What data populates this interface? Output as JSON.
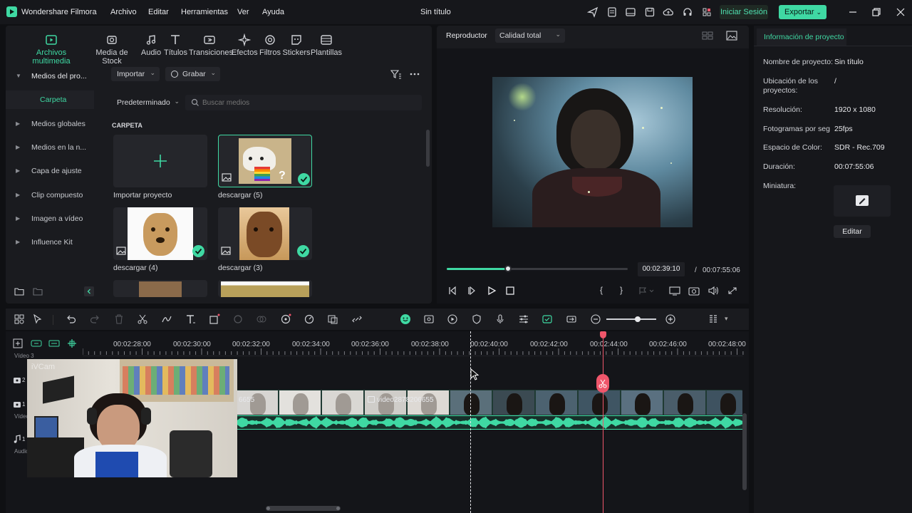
{
  "app": {
    "name": "Wondershare Filmora",
    "document_title": "Sin título",
    "menu": [
      "Archivo",
      "Editar",
      "Herramientas",
      "Ver",
      "Ayuda"
    ],
    "login_label": "Iniciar Sesión",
    "export_label": "Exportar"
  },
  "media": {
    "categories": [
      "Archivos multimedia",
      "Media de Stock",
      "Audio",
      "Títulos",
      "Transiciones",
      "Efectos",
      "Filtros",
      "Stickers",
      "Plantillas"
    ],
    "side_nav": {
      "header": "Medios del pro...",
      "items": [
        "Carpeta",
        "Medios globales",
        "Medios en la n...",
        "Capa de ajuste",
        "Clip compuesto",
        "Imagen a vídeo",
        "Influence Kit"
      ]
    },
    "import_label": "Importar",
    "record_label": "Grabar",
    "sort_label": "Predeterminado",
    "search_placeholder": "Buscar medios",
    "folder_heading": "CARPETA",
    "import_project_label": "Importar proyecto",
    "items": [
      "descargar (5)",
      "descargar (4)",
      "descargar (3)"
    ]
  },
  "player": {
    "label": "Reproductor",
    "quality": "Calidad total",
    "current_time": "00:02:39:10",
    "separator": "/",
    "total_time": "00:07:55:06",
    "progress": 0.34
  },
  "project_info": {
    "tab_label": "Información de proyecto",
    "fields": [
      {
        "label": "Nombre de proyecto:",
        "value": "Sin título"
      },
      {
        "label": "Ubicación de los proyectos:",
        "value": "/"
      },
      {
        "label": "Resolución:",
        "value": "1920 x 1080"
      },
      {
        "label": "Fotogramas por seg",
        "value": "25fps"
      },
      {
        "label": "Espacio de Color:",
        "value": "SDR - Rec.709"
      },
      {
        "label": "Duración:",
        "value": "00:07:55:06"
      },
      {
        "label": "Miniatura:",
        "value": ""
      }
    ],
    "edit_label": "Editar"
  },
  "timeline": {
    "ruler": [
      "00:02:28:00",
      "00:02:30:00",
      "00:02:32:00",
      "00:02:34:00",
      "00:02:36:00",
      "00:02:38:00",
      "00:02:40:00",
      "00:02:42:00",
      "00:02:44:00",
      "00:02:46:00",
      "00:02:48:00"
    ],
    "tracks": {
      "t3": "Vídeo 3",
      "t2": "2",
      "t1": "1",
      "video_label": "Vídeo",
      "audio_num": "1",
      "audio_label": "Audio"
    },
    "clip_label": "video2878206655",
    "clip_label_left": "6655",
    "webcam_watermark": "iVCam",
    "colors": {
      "accent": "#3fd9a3",
      "playhead": "#f0566b"
    }
  }
}
